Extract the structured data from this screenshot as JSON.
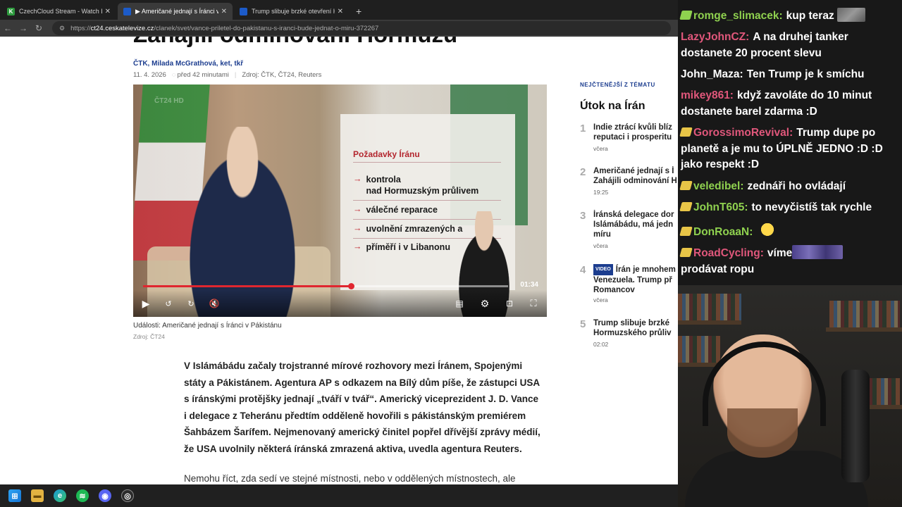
{
  "browser": {
    "tabs": [
      {
        "title": "CzechCloud Stream - Watch Live o",
        "favicon_color": "#2e9b3e",
        "favicon_glyph": "K",
        "active": false
      },
      {
        "title": "▶ Američané jednají s Íránci v Páki",
        "favicon_color": "#1c5bc9",
        "favicon_glyph": "",
        "active": true
      },
      {
        "title": "Trump slibuje brzké otevření Horm",
        "favicon_color": "#1c5bc9",
        "favicon_glyph": "",
        "active": false
      }
    ],
    "new_tab": "+",
    "url_host": "ct24.ceskatelevize.cz",
    "url_path": "/clanek/svet/vance-priletel-do-pakistanu-s-iranci-bude-jednat-o-miru-372267",
    "url_prefix": "https://"
  },
  "article": {
    "headline": "Zahájili odminování Hormuzu",
    "authors": "ČTK, Milada McGrathová, ket, tkř",
    "date": "11. 4. 2026",
    "time_ago": "před 42 minutami",
    "source": "Zdroj: ČTK, ČT24, Reuters",
    "video": {
      "overlay_title": "Požadavky Íránu",
      "demands": [
        "kontrola\nnad Hormuzským průlivem",
        "válečné reparace",
        "uvolnění zmrazených a",
        "příměří i v Libanonu"
      ],
      "duration": "01:34",
      "progress": 0.57,
      "logo": "ČT24 HD"
    },
    "caption": "Události: Američané jednají s Íránci v Pákistánu",
    "caption_source": "Zdroj: ČT24",
    "lead": "V Islámábádu začaly trojstranné mírové rozhovory mezi Íránem, Spojenými státy a Pákistánem. Agentura AP s odkazem na Bílý dům píše, že zástupci USA s íránskými protějšky jednají „tváří v tvář“. Americký viceprezident J. D. Vance i delegace z Teheránu předtím odděleně hovořili s pákistánským premiérem Šahbázem Šarífem. Nejmenovaný americký činitel popřel dřívější zprávy médií, že USA uvolnily některá íránská zmrazená aktiva, uvedla agentura Reuters.",
    "next_para": "Nemohu říct, zda sedí ve stejné místnosti, nebo v oddělených místnostech, ale"
  },
  "sidebar": {
    "label": "NEJČTENĚJŠÍ Z TÉMATU",
    "title": "Útok na Írán",
    "items": [
      {
        "num": "1",
        "text": "Indie ztrácí kvůli blíz\nreputaci i prosperitu",
        "time": "včera",
        "video": false
      },
      {
        "num": "2",
        "text": "Američané jednají s Í\nZahájili odminování H",
        "time": "19:25",
        "video": false
      },
      {
        "num": "3",
        "text": "Íránská delegace dor\nIslámábádu, má jedn\nmíru",
        "time": "včera",
        "video": false
      },
      {
        "num": "4",
        "text": "Írán je mnohem\nVenezuela. Trump př\nRomancov",
        "time": "včera",
        "video": true,
        "video_label": "VIDEO"
      },
      {
        "num": "5",
        "text": "Trump slibuje brzké\nHormuzského průliv",
        "time": "02:02",
        "video": false
      }
    ]
  },
  "chat": [
    {
      "user": "romge_slimacek:",
      "color": "#8fd14f",
      "text": "kup teraz",
      "emote": "photo"
    },
    {
      "user": "LazyJohnCZ:",
      "color": "#e0577b",
      "text": "A na druhej tanker dostanete 20 procent slevu",
      "badge": false
    },
    {
      "user": "John_Maza:",
      "color": "#ffffff",
      "text": "Ten Trump je k smíchu",
      "badge": false
    },
    {
      "user": "mikey861:",
      "color": "#e0577b",
      "text": "když zavoláte do 10 minut dostanete barel zdarma :D",
      "badge": false
    },
    {
      "user": "GorossimoRevival:",
      "color": "#e0577b",
      "text": "Trump dupe po planetě a je mu to ÚPLNĚ JEDNO :D :D jako respekt :D",
      "badge": true,
      "badge_color": "#e8c547"
    },
    {
      "user": "veledibel:",
      "color": "#8fd14f",
      "text": "zednáři ho ovládají",
      "badge": true,
      "badge_color": "#e8c547"
    },
    {
      "user": "JohnT605:",
      "color": "#8fd14f",
      "text": "to nevyčistíš tak rychle",
      "badge": true,
      "badge_color": "#e8c547"
    },
    {
      "user": "DonRoaaN:",
      "color": "#8fd14f",
      "text": "",
      "emote": "face",
      "badge": true,
      "badge_color": "#e8c547"
    },
    {
      "user": "RoadCycling:",
      "color": "#e0577b",
      "text": "víme",
      "text2": "prodávat ropu",
      "emote": "wide",
      "badge": true,
      "badge_color": "#e8c547"
    }
  ],
  "taskbar": {
    "icons": [
      "windows-start-icon",
      "file-explorer-icon",
      "edge-icon",
      "spotify-icon",
      "discord-icon",
      "obs-icon"
    ]
  }
}
